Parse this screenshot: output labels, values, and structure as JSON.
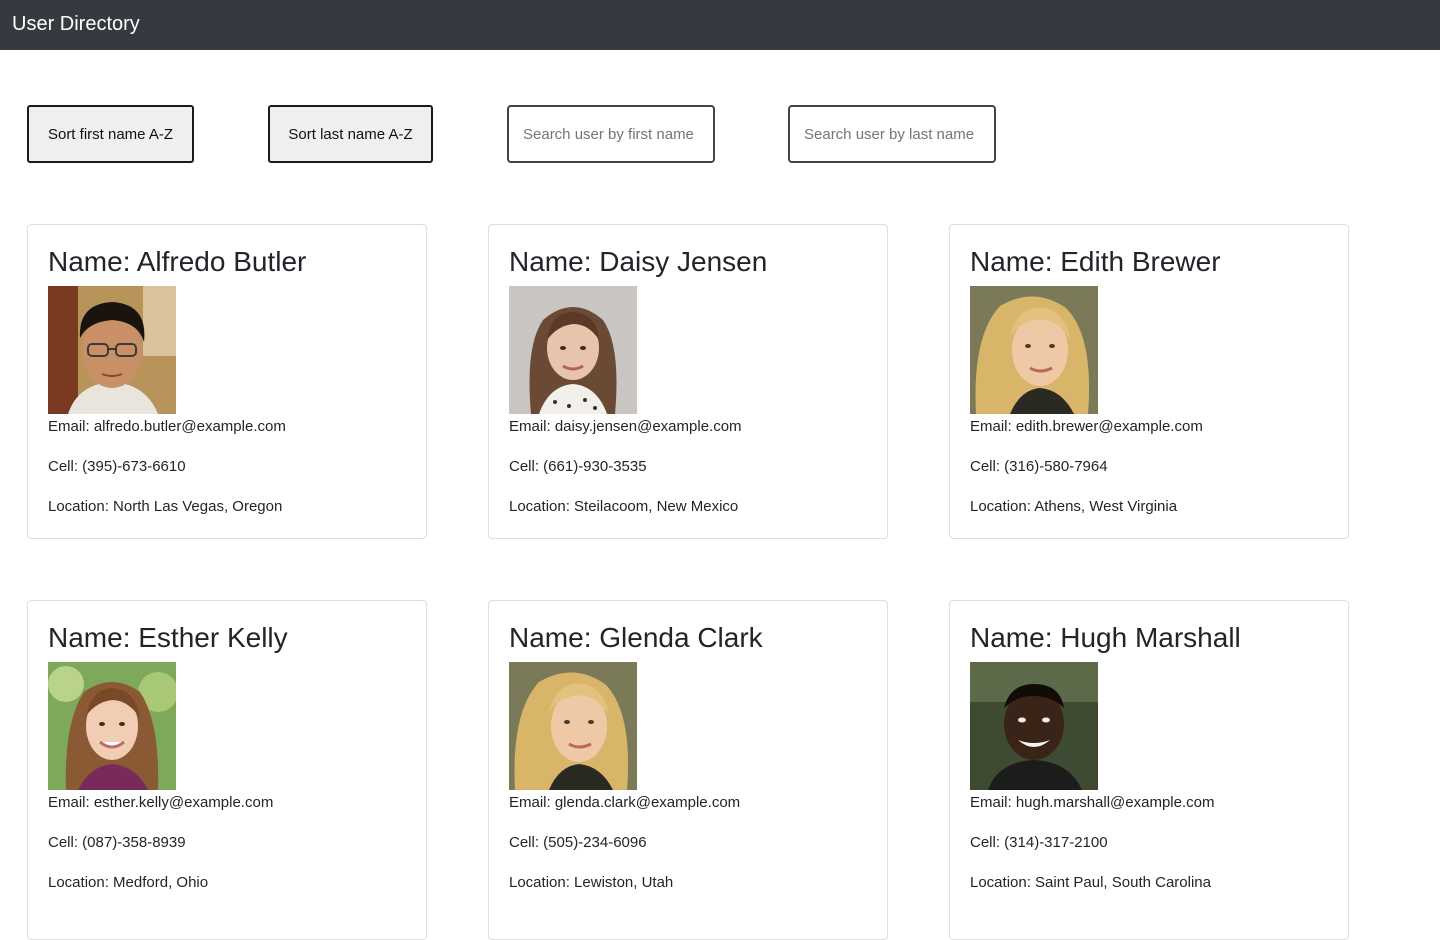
{
  "navbar": {
    "brand": "User Directory"
  },
  "controls": {
    "sort_first_label": "Sort first name A-Z",
    "sort_last_label": "Sort last name A-Z",
    "search_first_placeholder": "Search user by first name",
    "search_last_placeholder": "Search user by last name"
  },
  "users": [
    {
      "name": "Name: Alfredo Butler",
      "email": "Email: alfredo.butler@example.com",
      "cell": "Cell: (395)-673-6610",
      "location": "Location: North Las Vegas, Oregon"
    },
    {
      "name": "Name: Daisy Jensen",
      "email": "Email: daisy.jensen@example.com",
      "cell": "Cell: (661)-930-3535",
      "location": "Location: Steilacoom, New Mexico"
    },
    {
      "name": "Name: Edith Brewer",
      "email": "Email: edith.brewer@example.com",
      "cell": "Cell: (316)-580-7964",
      "location": "Location: Athens, West Virginia"
    },
    {
      "name": "Name: Esther Kelly",
      "email": "Email: esther.kelly@example.com",
      "cell": "Cell: (087)-358-8939",
      "location": "Location: Medford, Ohio"
    },
    {
      "name": "Name: Glenda Clark",
      "email": "Email: glenda.clark@example.com",
      "cell": "Cell: (505)-234-6096",
      "location": "Location: Lewiston, Utah"
    },
    {
      "name": "Name: Hugh Marshall",
      "email": "Email: hugh.marshall@example.com",
      "cell": "Cell: (314)-317-2100",
      "location": "Location: Saint Paul, South Carolina"
    }
  ]
}
